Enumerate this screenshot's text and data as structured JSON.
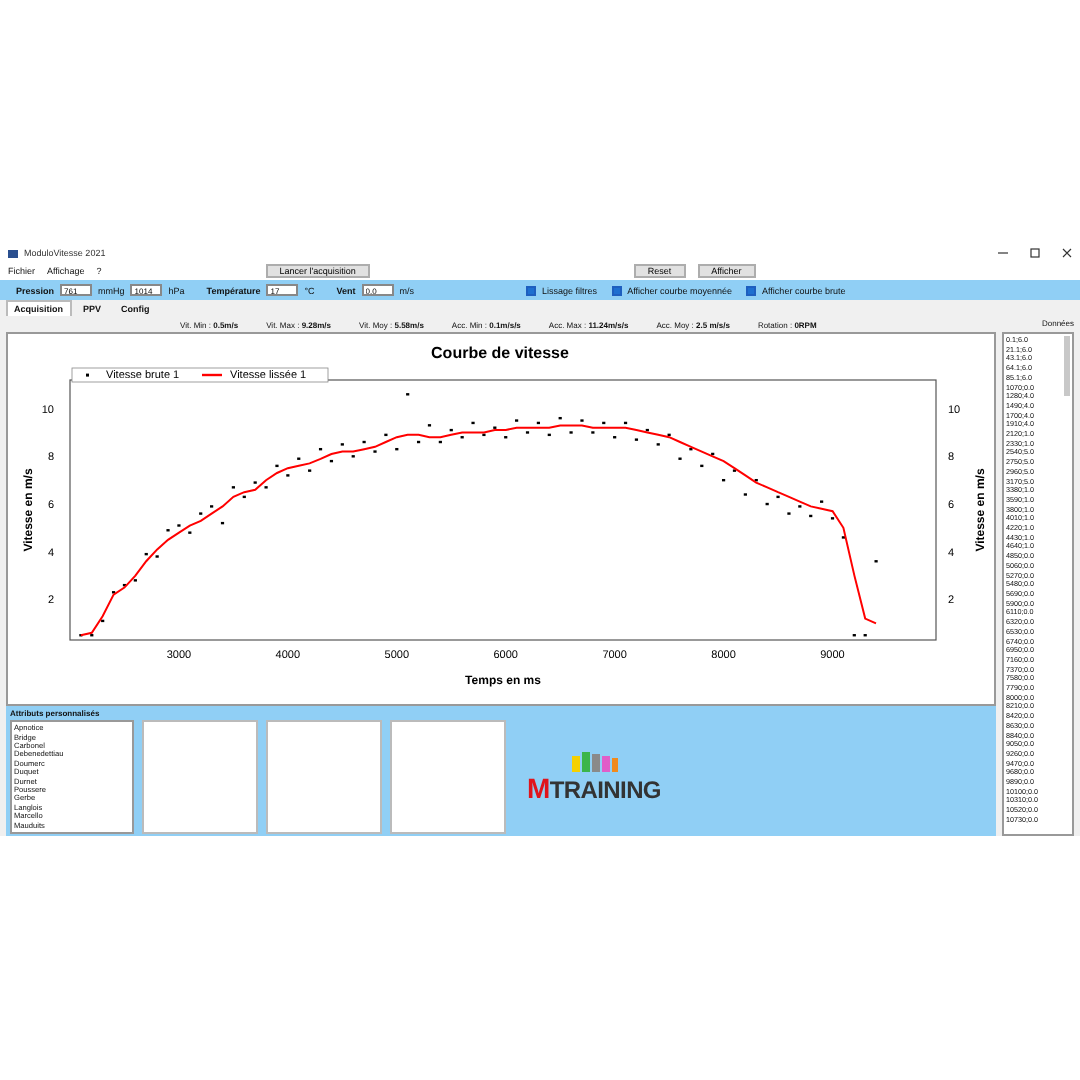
{
  "window": {
    "title": "ModuloVitesse 2021"
  },
  "menu": [
    "Fichier",
    "Affichage",
    "?"
  ],
  "buttons": [
    "Lancer l'acquisition",
    "Reset",
    "Afficher"
  ],
  "toolbar": {
    "fields": [
      {
        "label": "Pression",
        "value": "761",
        "unit": "mmHg"
      },
      {
        "value": "1014",
        "unit": "hPa"
      },
      {
        "label": "Température",
        "value": "17",
        "unit": "°C"
      },
      {
        "label": "Vent",
        "value": "0.0",
        "unit": "m/s"
      }
    ],
    "checkboxes": [
      {
        "label": "Lissage filtres",
        "checked": true
      },
      {
        "label": "Afficher courbe moyennée",
        "checked": true
      },
      {
        "label": "Afficher courbe brute",
        "checked": true
      }
    ]
  },
  "tabs": [
    {
      "label": "Acquisition",
      "selected": true
    },
    {
      "label": "PPV",
      "selected": false
    },
    {
      "label": "Config",
      "selected": false
    }
  ],
  "stats": [
    {
      "label": "Vit. Min :",
      "value": "0.5m/s"
    },
    {
      "label": "Vit. Max :",
      "value": "9.28m/s"
    },
    {
      "label": "Vit. Moy :",
      "value": "5.58m/s"
    },
    {
      "label": "Acc. Min :",
      "value": "0.1m/s/s"
    },
    {
      "label": "Acc. Max :",
      "value": "11.24m/s/s"
    },
    {
      "label": "Acc. Moy :",
      "value": "2.5 m/s/s"
    },
    {
      "label": "Rotation :",
      "value": "0RPM"
    }
  ],
  "chart_data": {
    "type": "scatter",
    "legend": "top left",
    "title": "Courbe de vitesse",
    "xlabel": "Temps en ms",
    "ylabel": "Vitesse en m/s",
    "xlim": [
      2000,
      9950
    ],
    "ylim": [
      0.3,
      11.2
    ],
    "xticks": [
      3000,
      4000,
      5000,
      6000,
      7000,
      8000,
      9000
    ],
    "yticks": [
      {
        "value": 2,
        "label": "2"
      },
      {
        "value": 4,
        "label": "4"
      },
      {
        "value": 6,
        "label": "6"
      },
      {
        "value": 8,
        "label": "8"
      },
      {
        "value": 10,
        "label": "10"
      }
    ],
    "x": [
      2100,
      2200,
      2300,
      2400,
      2500,
      2600,
      2700,
      2800,
      2900,
      3000,
      3100,
      3200,
      3300,
      3400,
      3500,
      3600,
      3700,
      3800,
      3900,
      4000,
      4100,
      4200,
      4300,
      4400,
      4500,
      4600,
      4700,
      4800,
      4900,
      5000,
      5100,
      5200,
      5300,
      5400,
      5500,
      5600,
      5700,
      5800,
      5900,
      6000,
      6100,
      6200,
      6300,
      6400,
      6500,
      6600,
      6700,
      6800,
      6900,
      7000,
      7100,
      7200,
      7300,
      7400,
      7500,
      7600,
      7700,
      7800,
      7900,
      8000,
      8100,
      8200,
      8300,
      8400,
      8500,
      8600,
      8700,
      8800,
      8900,
      9000,
      9100,
      9200,
      9300,
      9400
    ],
    "series": [
      {
        "name": "Vitesse brute 1",
        "color": "#000000",
        "marker": "square",
        "values": [
          0.5,
          0.5,
          1.1,
          2.3,
          2.6,
          2.8,
          3.9,
          3.8,
          4.9,
          5.1,
          4.8,
          5.6,
          5.9,
          5.2,
          6.7,
          6.3,
          6.9,
          6.7,
          7.6,
          7.2,
          7.9,
          7.4,
          8.3,
          7.8,
          8.5,
          8.0,
          8.6,
          8.2,
          8.9,
          8.3,
          10.6,
          8.6,
          9.3,
          8.6,
          9.1,
          8.8,
          9.4,
          8.9,
          9.2,
          8.8,
          9.5,
          9.0,
          9.4,
          8.9,
          9.6,
          9.0,
          9.5,
          9.0,
          9.4,
          8.8,
          9.4,
          8.7,
          9.1,
          8.5,
          8.9,
          7.9,
          8.3,
          7.6,
          8.1,
          7.0,
          7.4,
          6.4,
          7.0,
          6.0,
          6.3,
          5.6,
          5.9,
          5.5,
          6.1,
          5.4,
          4.6,
          0.5,
          0.5,
          3.6
        ]
      },
      {
        "name": "Vitesse lissée 1",
        "color": "#ff0000",
        "type": "line",
        "marker": "none",
        "values": [
          0.5,
          0.6,
          1.3,
          2.2,
          2.5,
          3.0,
          3.6,
          4.1,
          4.5,
          4.8,
          5.1,
          5.3,
          5.6,
          5.9,
          6.3,
          6.5,
          6.6,
          7.0,
          7.3,
          7.5,
          7.6,
          7.7,
          7.9,
          8.1,
          8.2,
          8.2,
          8.3,
          8.4,
          8.6,
          8.8,
          8.9,
          8.9,
          8.8,
          8.8,
          8.9,
          9.0,
          9.0,
          9.0,
          9.1,
          9.1,
          9.2,
          9.2,
          9.2,
          9.2,
          9.3,
          9.3,
          9.3,
          9.2,
          9.2,
          9.2,
          9.2,
          9.1,
          9.0,
          8.9,
          8.8,
          8.6,
          8.4,
          8.2,
          8.0,
          7.8,
          7.5,
          7.2,
          6.9,
          6.7,
          6.5,
          6.3,
          6.1,
          5.9,
          5.8,
          5.7,
          5.0,
          3.0,
          1.2,
          1.0
        ]
      }
    ]
  },
  "right_axis": {
    "ticks": [
      "10",
      "8",
      "6",
      "4",
      "2"
    ],
    "label": "Vitesse en m/s"
  },
  "data_list": {
    "label": "Données",
    "items": [
      "0.1;6.0",
      "21.1;6.0",
      "43.1;6.0",
      "64.1;6.0",
      "85.1;6.0",
      "1070;0.0",
      "1280;4.0",
      "1490;4.0",
      "1700;4.0",
      "1910;4.0",
      "2120;1.0",
      "2330;1.0",
      "2540;5.0",
      "2750;5.0",
      "2960;5.0",
      "3170;5.0",
      "3380;1.0",
      "3590;1.0",
      "3800;1.0",
      "4010;1.0",
      "4220;1.0",
      "4430;1.0",
      "4640;1.0",
      "4850;0.0",
      "5060;0.0",
      "5270;0.0",
      "5480;0.0",
      "5690;0.0",
      "5900;0.0",
      "6110;0.0",
      "6320;0.0",
      "6530;0.0",
      "6740;0.0",
      "6950;0.0",
      "7160;0.0",
      "7370;0.0",
      "7580;0.0",
      "7790;0.0",
      "8000;0.0",
      "8210;0.0",
      "8420;0.0",
      "8630;0.0",
      "8840;0.0",
      "9050;0.0",
      "9260;0.0",
      "9470;0.0",
      "9680;0.0",
      "9890;0.0",
      "10100;0.0",
      "10310;0.0",
      "10520;0.0",
      "10730;0.0"
    ]
  },
  "attributes": {
    "title": "Attributs personnalisés",
    "items": [
      "Apnotice",
      "Bridge",
      "Carbonel",
      "Debenedettiau",
      "Doumerc",
      "Duquet",
      "Durnet",
      "Poussere",
      "Gerbe",
      "Langlois",
      "Marcello",
      "Mauduits"
    ]
  },
  "logo": {
    "initial": "M",
    "rest": "TRAINING"
  }
}
